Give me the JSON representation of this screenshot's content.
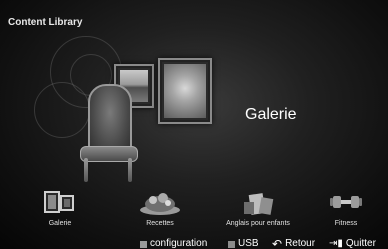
{
  "header": {
    "title": "Content Library"
  },
  "hero": {
    "selected_label": "Galerie"
  },
  "menu": {
    "items": [
      {
        "label": "Galerie",
        "icon": "gallery-icon"
      },
      {
        "label": "Recettes",
        "icon": "recipes-icon"
      },
      {
        "label": "Anglais pour enfants",
        "icon": "english-kids-icon"
      },
      {
        "label": "Fitness",
        "icon": "fitness-icon"
      }
    ]
  },
  "helpbar": {
    "configuration": "configuration",
    "usb": "USB",
    "retour": "Retour",
    "quitter": "Quitter"
  },
  "colors": {
    "background": "#000000",
    "text": "#ffffff",
    "key_square": "#9a9a9a"
  }
}
